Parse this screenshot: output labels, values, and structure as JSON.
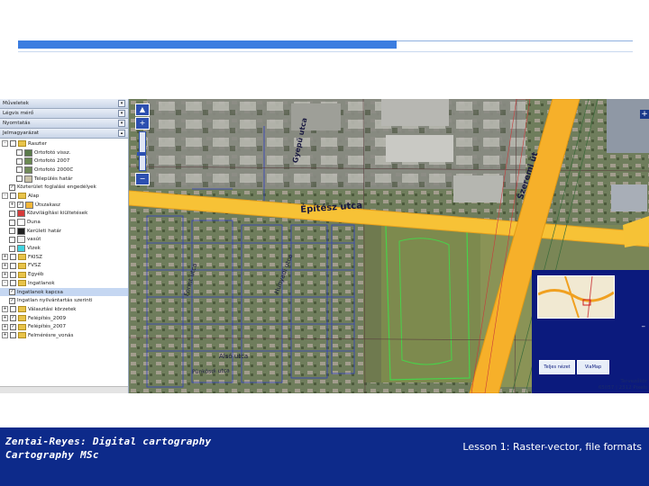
{
  "panel": {
    "sections": [
      {
        "title": "Műveletek",
        "collapse": "▾"
      },
      {
        "title": "Légvis mérő",
        "collapse": "▾"
      },
      {
        "title": "Nyomtatás",
        "collapse": "▾"
      },
      {
        "title": "Jelmagyarázat",
        "collapse": "▴"
      }
    ],
    "tree": [
      {
        "label": "Raszter",
        "level": 0,
        "expander": "-",
        "check": "",
        "folder": true
      },
      {
        "label": "Ortofotó vissz.",
        "level": 2,
        "expander": "",
        "check": "",
        "folder": false,
        "swatch": "#5a7a4a"
      },
      {
        "label": "Ortofotó 2007",
        "level": 2,
        "expander": "",
        "check": "",
        "folder": false,
        "swatch": "#6b8a52"
      },
      {
        "label": "Ortofotó 2000C",
        "level": 2,
        "expander": "",
        "check": "",
        "folder": false,
        "swatch": "#708a58"
      },
      {
        "label": "Település határ",
        "level": 2,
        "expander": "",
        "check": "",
        "folder": false,
        "swatch": "#c9c2a8"
      },
      {
        "label": "Közterület foglalási engedélyek",
        "level": 1,
        "expander": "",
        "check": "✓",
        "folder": false
      },
      {
        "label": "Alap",
        "level": 0,
        "expander": "-",
        "check": "",
        "folder": true
      },
      {
        "label": "Útszakasz",
        "level": 1,
        "expander": "+",
        "check": "✓",
        "folder": false,
        "swatch": "#f3b637"
      },
      {
        "label": "Közvilágítási kiültetések",
        "level": 1,
        "expander": "",
        "check": "",
        "folder": false,
        "swatch": "#d63a3a"
      },
      {
        "label": "Duna",
        "level": 1,
        "expander": "",
        "check": "",
        "folder": false,
        "swatch": "#ffffff"
      },
      {
        "label": "Kerületi határ",
        "level": 1,
        "expander": "",
        "check": "",
        "folder": false,
        "swatch": "#1f1f1f"
      },
      {
        "label": "vasút",
        "level": 1,
        "expander": "",
        "check": "",
        "folder": false,
        "swatch": "#f2f2f2"
      },
      {
        "label": "Vizek",
        "level": 1,
        "expander": "",
        "check": "",
        "folder": false,
        "swatch": "#3fd3e0"
      },
      {
        "label": "FKISZ",
        "level": 0,
        "expander": "+",
        "check": "",
        "folder": true
      },
      {
        "label": "FVSZ",
        "level": 0,
        "expander": "+",
        "check": "",
        "folder": true
      },
      {
        "label": "Egyéb",
        "level": 0,
        "expander": "+",
        "check": "",
        "folder": true
      },
      {
        "label": "Ingatlanok",
        "level": 0,
        "expander": "-",
        "check": "",
        "folder": true
      },
      {
        "label": "Ingatlanok kapcsa",
        "level": 1,
        "expander": "",
        "check": "✓",
        "folder": false,
        "selected": true
      },
      {
        "label": "Ingatlan nyilvántartás szerinti",
        "level": 1,
        "expander": "",
        "check": "✓",
        "folder": false
      },
      {
        "label": "Választási körzetek",
        "level": 0,
        "expander": "+",
        "check": "",
        "folder": true
      },
      {
        "label": "Felépítés_2009",
        "level": 0,
        "expander": "+",
        "check": "✓",
        "folder": true
      },
      {
        "label": "Felépítés_2007",
        "level": 0,
        "expander": "+",
        "check": "✓",
        "folder": true
      },
      {
        "label": "Felmérésre_vonás",
        "level": 0,
        "expander": "+",
        "check": "",
        "folder": true
      }
    ]
  },
  "map": {
    "nav": {
      "pan_up": "▲",
      "pan_left": "◀",
      "pan_right": "▶",
      "zoom_in": "+",
      "zoom_out": "−"
    },
    "labels": [
      {
        "text": "Építész utca",
        "size": 10,
        "rotate": -4,
        "color": "#1a1a40",
        "weight": "bold"
      },
      {
        "text": "Gyepű utca",
        "size": 8,
        "rotate": -78,
        "color": "#1a1a40",
        "weight": "bold"
      },
      {
        "text": "Szeremi út",
        "size": 9,
        "rotate": -72,
        "color": "#1a1a40",
        "weight": "bold"
      },
      {
        "text": "Forint utca",
        "size": 7,
        "rotate": -75,
        "color": "#1a1a40",
        "weight": "normal"
      },
      {
        "text": "Hunyadi utca",
        "size": 7,
        "rotate": -70,
        "color": "#1a1a40",
        "weight": "normal"
      },
      {
        "text": "Alsó utca",
        "size": 7,
        "rotate": 0,
        "color": "#1a1a40",
        "weight": "normal"
      },
      {
        "text": "Pünkösdi utca",
        "size": 6,
        "rotate": -2,
        "color": "#1a1a40",
        "weight": "normal"
      }
    ],
    "overview_btn1": "Teljes nézet",
    "overview_btn2": "ViaMap",
    "overview_toggle": "–",
    "corner_plus": "+",
    "coords": [
      "Tervezőkör",
      "65057 | 2312 Pixels"
    ]
  },
  "footer": {
    "left_line1": "Zentai-Reyes: Digital cartography",
    "left_line2": "Cartography MSc",
    "right": "Lesson 1: Raster-vector, file formats"
  }
}
